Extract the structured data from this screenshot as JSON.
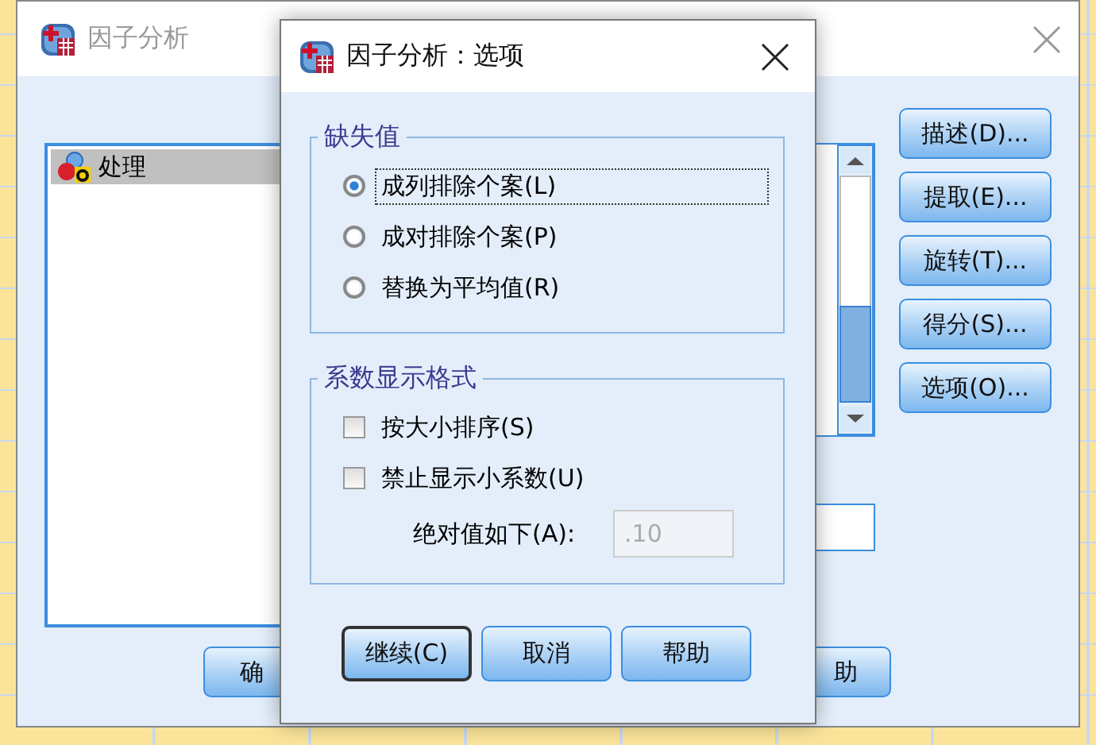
{
  "main_window": {
    "title": "因子分析",
    "variables": [
      {
        "label": "处理",
        "selected": true
      }
    ],
    "side_buttons": [
      {
        "label": "描述(D)..."
      },
      {
        "label": "提取(E)..."
      },
      {
        "label": "旋转(T)..."
      },
      {
        "label": "得分(S)..."
      },
      {
        "label": "选项(O)..."
      }
    ],
    "bottom_buttons": [
      {
        "label": "确"
      },
      {
        "label": "助"
      }
    ]
  },
  "dialog": {
    "title": "因子分析：选项",
    "missing_values": {
      "title": "缺失值",
      "options": [
        {
          "label": "成列排除个案(L)",
          "selected": true,
          "focused": true
        },
        {
          "label": "成对排除个案(P)",
          "selected": false,
          "focused": false
        },
        {
          "label": "替换为平均值(R)",
          "selected": false,
          "focused": false
        }
      ]
    },
    "coefficient_format": {
      "title": "系数显示格式",
      "checkboxes": [
        {
          "label": "按大小排序(S)",
          "checked": false
        },
        {
          "label": "禁止显示小系数(U)",
          "checked": false
        }
      ],
      "threshold": {
        "label": "绝对值如下(A):",
        "value": ".10",
        "disabled": true
      }
    },
    "buttons": [
      {
        "label": "继续(C)",
        "default": true
      },
      {
        "label": "取消",
        "default": false
      },
      {
        "label": "帮助",
        "default": false
      }
    ]
  }
}
